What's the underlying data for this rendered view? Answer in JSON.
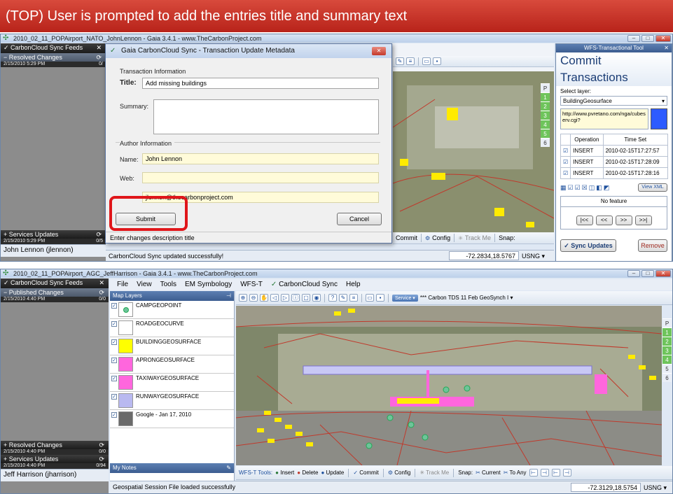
{
  "banner": {
    "text": "(TOP) User is prompted to add the entries title and summary text"
  },
  "top": {
    "window_title": "2010_02_11_POPAirport_NATO_JohnLennon - Gaia 3.4.1 - www.TheCarbonProject.com",
    "feeds_label": "CarbonCloud Sync Feeds",
    "resolved": {
      "label": "Resolved Changes",
      "date": "2/15/2010 5:29 PM",
      "count": "0/"
    },
    "services": {
      "label": "Services Updates",
      "date": "2/15/2010 5:29 PM",
      "count": "0/5"
    },
    "user": "John Lennon (jlennon)",
    "status": "CarbonCloud Sync updated successfully!",
    "coords": "-72.2834,18.5767",
    "datum": "USNG",
    "toolbar": {
      "commit": "Commit",
      "config": "Config",
      "track": "Track Me",
      "snap": "Snap:"
    },
    "side_numbers": [
      "P",
      "1",
      "2",
      "3",
      "4",
      "5",
      "6"
    ]
  },
  "dialog": {
    "title": "Gaia CarbonCloud Sync - Transaction Update Metadata",
    "section_transaction": "Transaction Information",
    "title_label": "Title:",
    "title_value": "Add missing buildings",
    "summary_label": "Summary:",
    "section_author": "Author Information",
    "name_label": "Name:",
    "name_value": "John Lennon",
    "web_label": "Web:",
    "email_value": "jlennon@thecarbonproject.com",
    "submit": "Submit",
    "cancel": "Cancel",
    "hint": "Enter changes description title"
  },
  "wfs": {
    "header": "WFS-Transactional Tool",
    "heading": "Commit Transactions",
    "select_layer_label": "Select layer:",
    "layer": "BuildingGeosurface",
    "url": "http://www.pvretano.com/nga/cubeserv.cgi?",
    "columns": [
      "Operation",
      "Time Set"
    ],
    "rows": [
      {
        "op": "INSERT",
        "time": "2010-02-15T17:27:57"
      },
      {
        "op": "INSERT",
        "time": "2010-02-15T17:28:09"
      },
      {
        "op": "INSERT",
        "time": "2010-02-15T17:28:16"
      }
    ],
    "view_xml": "View XML",
    "no_feature": "No feature",
    "nav": [
      "|<<",
      "<<",
      ">>",
      ">>|"
    ],
    "sync_updates": "Sync Updates",
    "remove": "Remove"
  },
  "bottom": {
    "window_title": "2010_02_11_POPAirport_AGC_JeffHarrison - Gaia 3.4.1 - www.TheCarbonProject.com",
    "feeds_label": "CarbonCloud Sync Feeds",
    "published": {
      "label": "Published Changes",
      "date": "2/15/2010 4:40 PM",
      "count": "0/0"
    },
    "resolved": {
      "label": "Resolved Changes",
      "date": "2/15/2010 4:40 PM",
      "count": "0/0"
    },
    "services": {
      "label": "Services Updates",
      "date": "2/15/2010 4:40 PM",
      "count": "0/94"
    },
    "user": "Jeff Harrison (jharrison)",
    "menu": [
      "File",
      "View",
      "Tools",
      "EM Symbology",
      "WFS-T",
      "CarbonCloud Sync",
      "Help"
    ],
    "map_layers_label": "Map Layers",
    "layers": [
      {
        "name": "CAMPGEOPOINT",
        "color": "#ffffff",
        "checked": true
      },
      {
        "name": "ROADGEOCURVE",
        "color": "#ffffff",
        "checked": true
      },
      {
        "name": "BUILDINGGEOSURFACE",
        "color": "#ffff00",
        "checked": true
      },
      {
        "name": "APRONGEOSURFACE",
        "color": "#ff66dd",
        "checked": true
      },
      {
        "name": "TAXIWAYGEOSURFACE",
        "color": "#ff66dd",
        "checked": true
      },
      {
        "name": "RUNWAYGEOSURFACE",
        "color": "#b9b9f0",
        "checked": true
      },
      {
        "name": "Google - Jan 17, 2010",
        "color": "#6a6a6a",
        "checked": true
      }
    ],
    "my_notes": "My Notes",
    "service_btn": "Service",
    "service_text": "*** Carbon TDS 11 Feb GeoSynch I",
    "tools": {
      "label": "WFS-T Tools:",
      "insert": "Insert",
      "delete": "Delete",
      "update": "Update",
      "commit": "Commit",
      "config": "Config",
      "track": "Track Me",
      "snap": "Snap:",
      "current": "Current",
      "to_any": "To Any"
    },
    "status": "Geospatial Session File loaded successfully",
    "coords": "-72.3129,18.5754",
    "datum": "USNG",
    "side_numbers": [
      "P",
      "1",
      "2",
      "3",
      "4",
      "5",
      "6"
    ]
  },
  "colors": {
    "banner": "#c9302a",
    "highlight": "#e0161a",
    "accent": "#2c5aa0"
  }
}
